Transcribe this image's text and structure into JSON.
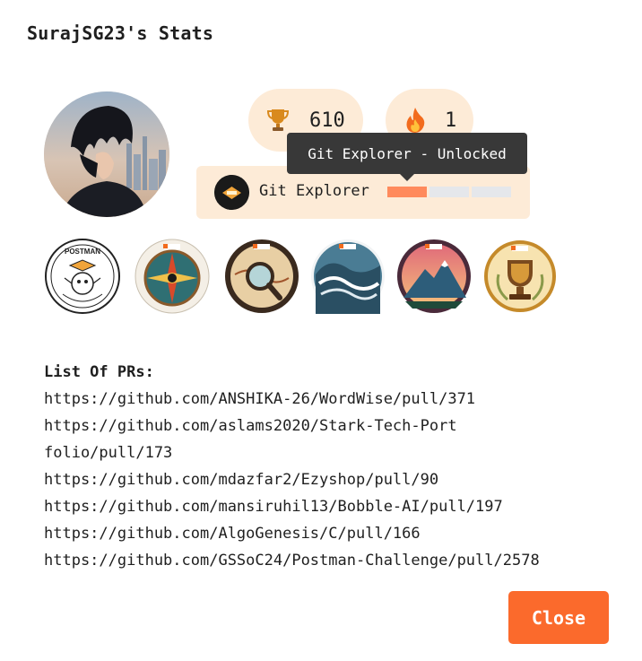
{
  "modal": {
    "title": "SurajSG23's Stats"
  },
  "stats": {
    "points": "610",
    "points_icon": "trophy-icon",
    "streak": "1",
    "streak_icon": "fire-icon"
  },
  "current_badge": {
    "name": "Git Explorer",
    "tooltip": "Git Explorer - Unlocked",
    "progress_segments_filled": 1,
    "progress_segments_total": 3
  },
  "badges": [
    {
      "name": "postman-api-fundamentals-badge",
      "text": "POSTMAN"
    },
    {
      "name": "compass-badge"
    },
    {
      "name": "magnifier-map-badge"
    },
    {
      "name": "wave-badge"
    },
    {
      "name": "mountain-badge"
    },
    {
      "name": "trophy-badge"
    }
  ],
  "prs": {
    "heading": "List Of PRs:",
    "items": [
      "https://github.com/ANSHIKA-26/WordWise/pull/371",
      "https://github.com/aslams2020/Stark-Tech-Portfolio/pull/173",
      "https://github.com/mdazfar2/Ezyshop/pull/90",
      "https://github.com/mansiruhil13/Bobble-AI/pull/197",
      "https://github.com/AlgoGenesis/C/pull/166",
      "https://github.com/GSSoC24/Postman-Challenge/pull/2578"
    ]
  },
  "actions": {
    "close_label": "Close"
  },
  "colors": {
    "accent": "#fb6a2c",
    "pill_bg": "#fdebd7",
    "progress_fill": "#ff8a5c",
    "tooltip_bg": "#383838"
  }
}
